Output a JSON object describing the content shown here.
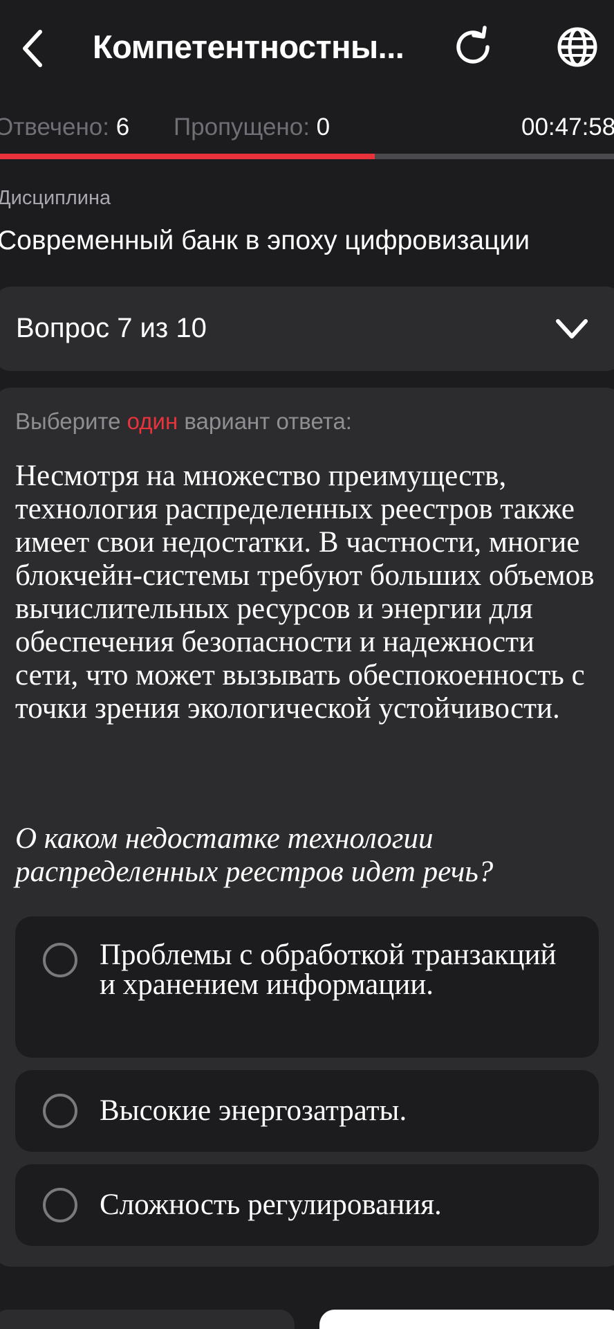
{
  "header": {
    "title": "Компетентностны...",
    "back_icon": "chevron-left-icon",
    "refresh_icon": "refresh-icon",
    "language_icon": "globe-icon"
  },
  "stats": {
    "answered_label": "Отвечено:",
    "answered_value": "6",
    "skipped_label": "Пропущено:",
    "skipped_value": "0",
    "timer": "00:47:58",
    "progress": 0.61
  },
  "discipline": {
    "label": "Дисциплина",
    "value": "Современный банк в эпоху цифровизации"
  },
  "question_selector": {
    "label": "Вопрос 7 из 10"
  },
  "question": {
    "instruction_before": "Выберите",
    "instruction_accent": "один",
    "instruction_after": "вариант ответа:",
    "text": "Несмотря на множество преимуществ, технология распределенных реестров также имеет свои недостатки. В частности, многие блокчейн-системы требуют больших объемов вычислительных ресурсов и энергии для обеспечения безопасности и надежности сети, что может вызывать обеспокоенность с точки зрения экологической устойчивости.",
    "prompt": "О каком недостатке технологии распределенных реестров идет речь?",
    "options": [
      {
        "text": "Проблемы с обработкой транзакций и хранением информации."
      },
      {
        "text": "Высокие энергозатраты."
      },
      {
        "text": "Сложность регулирования."
      }
    ]
  },
  "colors": {
    "background": "#1c1c1e",
    "card": "#2c2c2e",
    "accent": "#e8323c",
    "muted": "#8e8e93"
  }
}
